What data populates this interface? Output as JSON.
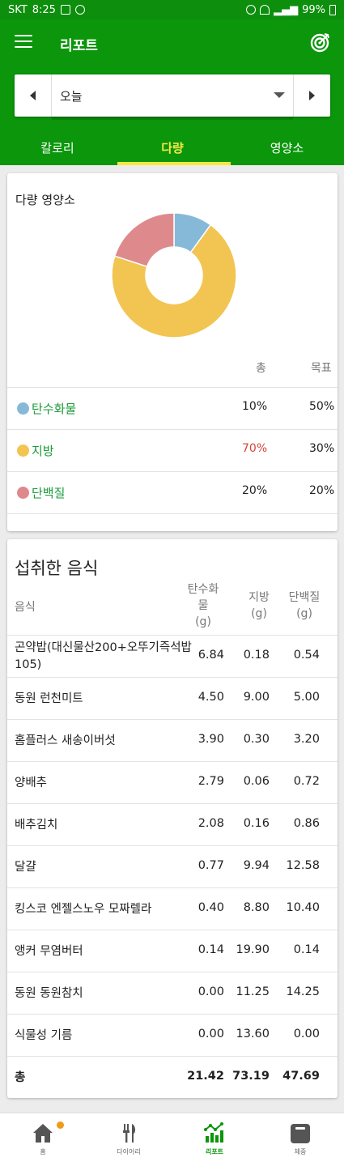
{
  "status_bar": {
    "carrier": "SKT",
    "time": "8:25",
    "battery": "99%"
  },
  "app_bar": {
    "title": "리포트"
  },
  "date_selector": {
    "selected": "오늘"
  },
  "tabs": [
    {
      "label": "칼로리",
      "active": false
    },
    {
      "label": "다량",
      "active": true
    },
    {
      "label": "영양소",
      "active": false
    }
  ],
  "macros_card": {
    "title": "다량 영양소",
    "col_total": "총",
    "col_goal": "목표",
    "rows": [
      {
        "name": "탄수화물",
        "total": "10%",
        "goal": "50%",
        "color": "#86b9d7",
        "percent": 10,
        "over": false
      },
      {
        "name": "지방",
        "total": "70%",
        "goal": "30%",
        "color": "#f2c452",
        "percent": 70,
        "over": true
      },
      {
        "name": "단백질",
        "total": "20%",
        "goal": "20%",
        "color": "#de8a8c",
        "percent": 20,
        "over": false
      }
    ]
  },
  "foods_card": {
    "title": "섭취한 음식",
    "headers": {
      "food": "음식",
      "carbs_line1": "탄수화",
      "carbs_line2": "물",
      "carbs_unit": "(g)",
      "fat": "지방",
      "fat_unit": "(g)",
      "protein": "단백질",
      "protein_unit": "(g)"
    },
    "rows": [
      {
        "name": "곤약밥(대신물산200+오뚜기즉석밥105)",
        "carbs": "6.84",
        "fat": "0.18",
        "protein": "0.54"
      },
      {
        "name": "동원 런천미트",
        "carbs": "4.50",
        "fat": "9.00",
        "protein": "5.00"
      },
      {
        "name": "홈플러스 새송이버섯",
        "carbs": "3.90",
        "fat": "0.30",
        "protein": "3.20"
      },
      {
        "name": "양배추",
        "carbs": "2.79",
        "fat": "0.06",
        "protein": "0.72"
      },
      {
        "name": "배추김치",
        "carbs": "2.08",
        "fat": "0.16",
        "protein": "0.86"
      },
      {
        "name": "달걀",
        "carbs": "0.77",
        "fat": "9.94",
        "protein": "12.58"
      },
      {
        "name": "킹스코 엔젤스노우 모짜렐라",
        "carbs": "0.40",
        "fat": "8.80",
        "protein": "10.40"
      },
      {
        "name": "앵커 무염버터",
        "carbs": "0.14",
        "fat": "19.90",
        "protein": "0.14"
      },
      {
        "name": "동원 동원참치",
        "carbs": "0.00",
        "fat": "11.25",
        "protein": "14.25"
      },
      {
        "name": "식물성 기름",
        "carbs": "0.00",
        "fat": "13.60",
        "protein": "0.00"
      }
    ],
    "total": {
      "name": "총",
      "carbs": "21.42",
      "fat": "73.19",
      "protein": "47.69"
    }
  },
  "bottom_nav": [
    {
      "label": "홈",
      "icon": "home-icon",
      "active": false
    },
    {
      "label": "다이어리",
      "icon": "diary-icon",
      "active": false
    },
    {
      "label": "리포트",
      "icon": "report-icon",
      "active": true
    },
    {
      "label": "체중",
      "icon": "scale-icon",
      "active": false
    }
  ],
  "colors": {
    "primary": "#0b960b",
    "accent": "#f4e842",
    "over": "#d3453b",
    "macro_name": "#1a9a3a"
  }
}
